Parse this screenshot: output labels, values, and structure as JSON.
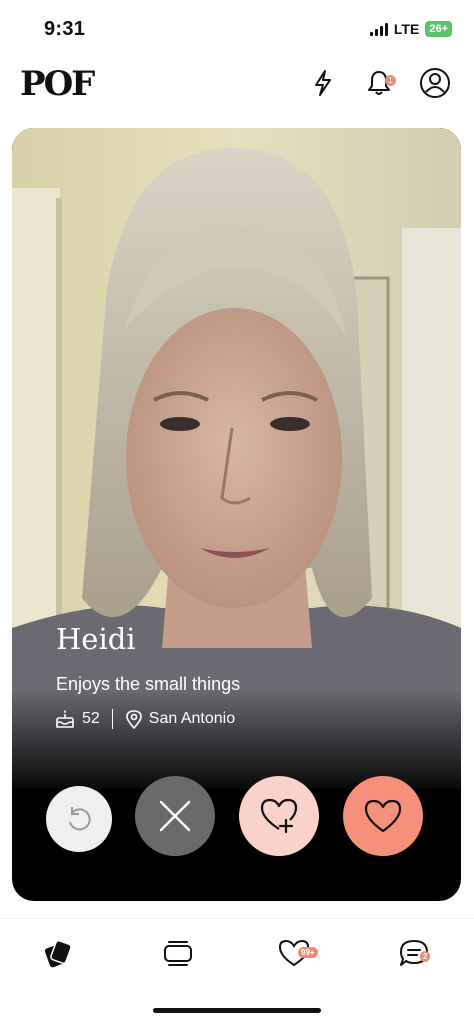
{
  "status_bar": {
    "time": "9:31",
    "network": "LTE",
    "battery": "26+"
  },
  "header": {
    "logo": "POF",
    "icons": [
      "lightning-icon",
      "bell-icon",
      "profile-icon"
    ],
    "notification_count": "1"
  },
  "profile": {
    "name": "Heidi",
    "bio": "Enjoys the small things",
    "age": "52",
    "location": "San Antonio"
  },
  "actions": [
    "undo",
    "pass",
    "superlike",
    "like"
  ],
  "bottom_nav": {
    "items": [
      "meet-me",
      "feed",
      "likes",
      "messages"
    ],
    "likes_badge": "99+",
    "messages_badge": "2"
  },
  "colors": {
    "accent": "#f5907a",
    "accent_light": "#f9d3c9",
    "badge": "#f08a6f"
  }
}
